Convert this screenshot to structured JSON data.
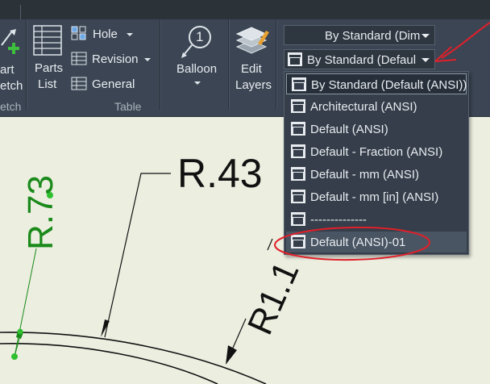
{
  "ribbon": {
    "sketch": {
      "line1": "art",
      "line2": "etch",
      "panel_label": "etch"
    },
    "parts_list": {
      "line1": "Parts",
      "line2": "List"
    },
    "hole": "Hole",
    "revision": "Revision",
    "general": "General",
    "table_panel_label": "Table",
    "balloon": "Balloon",
    "balloon_number": "1",
    "edit_layers": {
      "line1": "Edit",
      "line2": "Layers"
    },
    "style_combo_1": "By Standard (Dim",
    "style_combo_2": "By Standard (Defaul"
  },
  "dropdown": {
    "items": [
      "By Standard (Default (ANSI))",
      "Architectural (ANSI)",
      "Default (ANSI)",
      "Default - Fraction (ANSI)",
      "Default - mm (ANSI)",
      "Default - mm [in] (ANSI)",
      "--------------",
      "Default (ANSI)-01"
    ],
    "selected_index": 0,
    "highlighted_index": 7
  },
  "drawing": {
    "dim_r43": "R.43",
    "dim_r73": "R.73",
    "dim_r1": "R1.1"
  },
  "colors": {
    "ribbon_bg": "#3b4553",
    "canvas_bg": "#eceee0",
    "annotation_red": "#e0202a",
    "dim_green": "#1a8a1a"
  }
}
